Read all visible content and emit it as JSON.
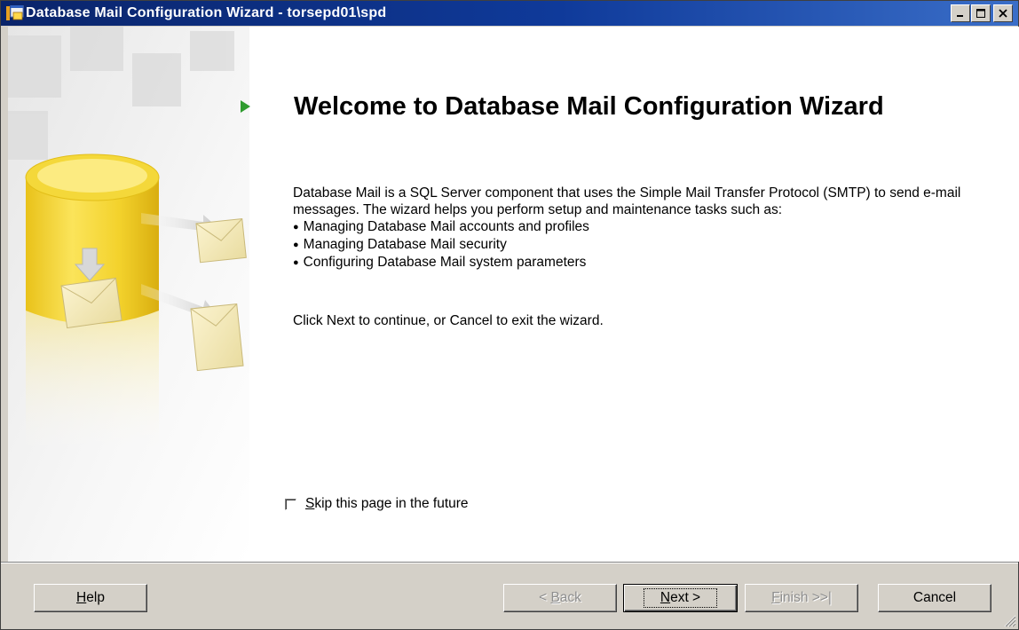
{
  "window": {
    "title": "Database Mail Configuration Wizard - torsepd01\\spd"
  },
  "main": {
    "heading": "Welcome to Database Mail Configuration Wizard",
    "intro": "Database Mail is a SQL Server component that uses the Simple Mail Transfer Protocol (SMTP) to send e-mail messages. The wizard helps you perform setup and maintenance tasks such as:",
    "bullets": [
      "Managing Database Mail accounts and profiles",
      "Managing Database Mail security",
      "Configuring Database Mail system parameters"
    ],
    "continue_text": "Click Next to continue, or Cancel to exit the wizard.",
    "skip_checkbox": {
      "mnemonic": "S",
      "label_rest": "kip this page in the future",
      "checked": false
    }
  },
  "buttons": {
    "help": {
      "mnemonic": "H",
      "rest": "elp",
      "enabled": true
    },
    "back": {
      "prefix": "< ",
      "mnemonic": "B",
      "rest": "ack",
      "enabled": false
    },
    "next": {
      "mnemonic": "N",
      "rest": "ext >",
      "enabled": true,
      "default": true
    },
    "finish": {
      "mnemonic": "F",
      "rest": "inish >>|",
      "enabled": false
    },
    "cancel": {
      "label": "Cancel",
      "enabled": true
    }
  },
  "colors": {
    "titlebar_start": "#0a246a",
    "titlebar_end": "#3a6ec8",
    "accent_arrow": "#2e9b2e",
    "cylinder_yellow": "#f5d92a"
  }
}
